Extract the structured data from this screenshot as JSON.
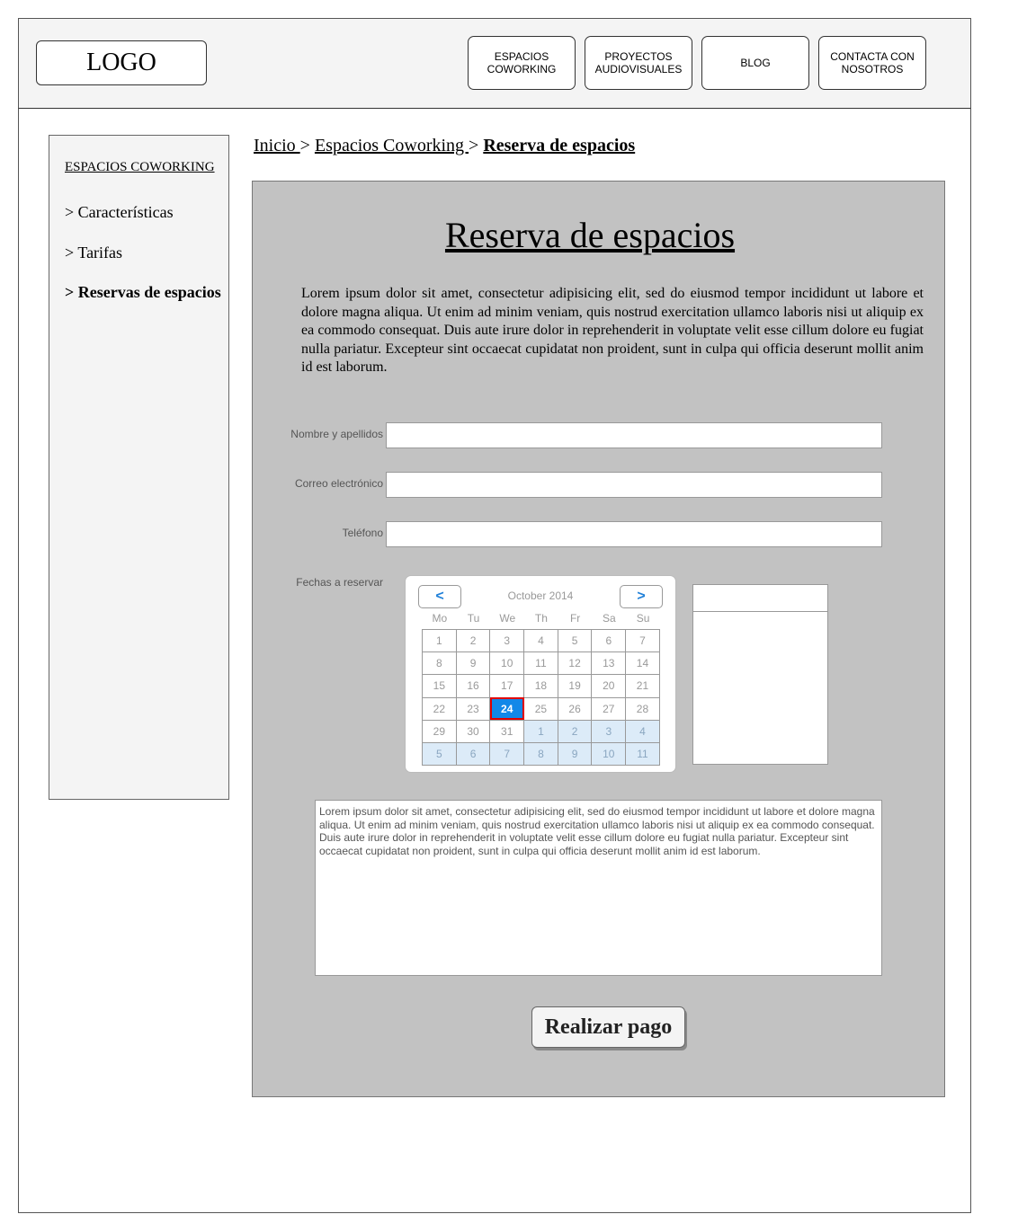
{
  "header": {
    "logo": "LOGO",
    "nav": [
      {
        "label": "ESPACIOS\nCOWORKING"
      },
      {
        "label": "PROYECTOS\nAUDIOVISUALES"
      },
      {
        "label": "BLOG"
      },
      {
        "label": "CONTACTA CON\nNOSOTROS"
      }
    ]
  },
  "sidebar": {
    "title": "ESPACIOS COWORKING",
    "items": [
      {
        "label": "> Características"
      },
      {
        "label": "> Tarifas"
      },
      {
        "label": "> Reservas de espacios"
      }
    ]
  },
  "breadcrumb": {
    "home": "Inicio ",
    "sep1": "> ",
    "section": "Espacios Coworking ",
    "sep2": "> ",
    "current": "Reserva de espacios"
  },
  "main": {
    "title": "Reserva de espacios",
    "intro": "Lorem ipsum dolor sit amet, consectetur adipisicing elit, sed do eiusmod tempor incididunt ut labore et dolore magna aliqua. Ut enim ad minim veniam, quis nostrud exercitation ullamco laboris nisi ut aliquip ex ea commodo consequat. Duis aute irure dolor in reprehenderit in voluptate velit esse cillum dolore eu fugiat nulla pariatur. Excepteur sint occaecat cupidatat non proident, sunt in culpa qui officia deserunt mollit anim id est laborum."
  },
  "form": {
    "name_label": "Nombre y apellidos",
    "name_value": "",
    "email_label": "Correo electrónico",
    "email_value": "",
    "phone_label": "Teléfono",
    "phone_value": "",
    "dates_label": "Fechas a reservar",
    "comments": "Lorem ipsum dolor sit amet, consectetur adipisicing elit, sed do eiusmod tempor incididunt ut labore et dolore magna aliqua. Ut enim ad minim veniam, quis nostrud exercitation ullamco laboris nisi ut aliquip ex ea commodo consequat. Duis aute irure dolor in reprehenderit in voluptate velit esse cillum dolore eu fugiat nulla pariatur. Excepteur sint occaecat cupidatat non proident, sunt in culpa qui officia deserunt mollit anim id est laborum.",
    "pay_button": "Realizar pago"
  },
  "calendar": {
    "prev": "<",
    "next": ">",
    "month": "October 2014",
    "weekdays": [
      "Mo",
      "Tu",
      "We",
      "Th",
      "Fr",
      "Sa",
      "Su"
    ],
    "selected_day": "24",
    "weeks": [
      [
        "1",
        "2",
        "3",
        "4",
        "5",
        "6",
        "7"
      ],
      [
        "8",
        "9",
        "10",
        "11",
        "12",
        "13",
        "14"
      ],
      [
        "15",
        "16",
        "17",
        "18",
        "19",
        "20",
        "21"
      ],
      [
        "22",
        "23",
        "24",
        "25",
        "26",
        "27",
        "28"
      ],
      [
        "29",
        "30",
        "31",
        "1",
        "2",
        "3",
        "4"
      ],
      [
        "5",
        "6",
        "7",
        "8",
        "9",
        "10",
        "11"
      ]
    ],
    "next_month_cells": [
      [
        4,
        3
      ],
      [
        4,
        4
      ],
      [
        4,
        5
      ],
      [
        4,
        6
      ],
      [
        5,
        0
      ],
      [
        5,
        1
      ],
      [
        5,
        2
      ],
      [
        5,
        3
      ],
      [
        5,
        4
      ],
      [
        5,
        5
      ],
      [
        5,
        6
      ]
    ]
  }
}
